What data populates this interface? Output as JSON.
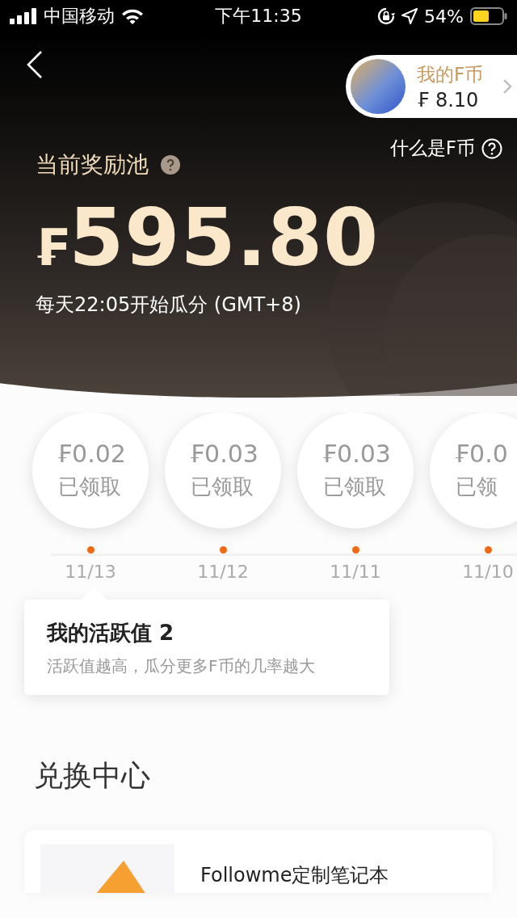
{
  "status_bar": {
    "carrier": "中国移动",
    "time": "下午11:35",
    "battery": "54%"
  },
  "header": {
    "wallet": {
      "label": "我的F币",
      "amount": "₣ 8.10"
    },
    "help_link": "什么是F币"
  },
  "pool": {
    "title": "当前奖励池",
    "currency": "₣",
    "amount": "595.80",
    "schedule": "每天22:05开始瓜分 (GMT+8)"
  },
  "rewards": [
    {
      "amount": "₣0.02",
      "status": "已领取",
      "date": "11/13"
    },
    {
      "amount": "₣0.03",
      "status": "已领取",
      "date": "11/12"
    },
    {
      "amount": "₣0.03",
      "status": "已领取",
      "date": "11/11"
    },
    {
      "amount": "₣0.0",
      "status": "已领",
      "date": "11/10"
    }
  ],
  "activity": {
    "title": "我的活跃值 2",
    "description": "活跃值越高，瓜分更多F币的几率越大"
  },
  "exchange": {
    "title": "兑换中心",
    "products": [
      {
        "name": "Followme定制笔记本"
      }
    ]
  }
}
